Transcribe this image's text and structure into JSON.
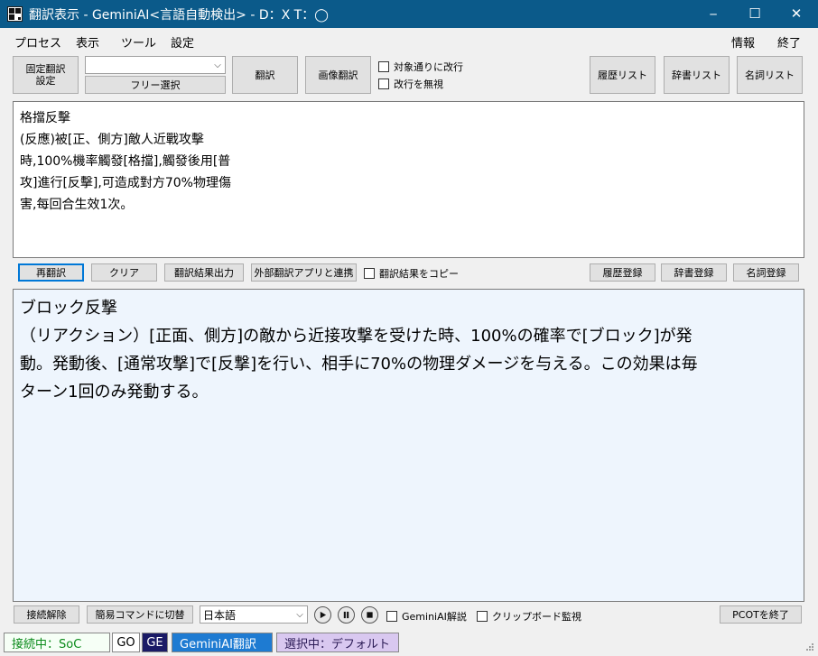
{
  "window": {
    "title": "翻訳表示 - GeminiAI<言語自動検出> - D：X T：◯",
    "minimize_glyph": "─",
    "maximize_glyph": "☐",
    "close_glyph": "✕"
  },
  "menu": {
    "items": [
      "プロセス",
      "表示",
      "ツール",
      "設定"
    ],
    "right_items": [
      "情報",
      "終了"
    ]
  },
  "toolbar": {
    "fixed_translation_settings": "固定翻訳\n設定",
    "combo_value": "",
    "free_select": "フリー選択",
    "translate": "翻訳",
    "image_translate": "画像翻訳",
    "check_newline_per_target": "対象通りに改行",
    "check_ignore_newline": "改行を無視",
    "history_list": "履歴リスト",
    "dictionary_list": "辞書リスト",
    "noun_list": "名詞リスト"
  },
  "source": {
    "text": "格擋反擊\n(反應)被[正、側方]敵人近戰攻擊\n時,100%機率觸發[格擋],觸發後用[普\n攻]進行[反擊],可造成對方70%物理傷\n害,每回合生效1次。"
  },
  "midbar": {
    "retranslate": "再翻訳",
    "clear": "クリア",
    "output_result": "翻訳結果出力",
    "external_link": "外部翻訳アプリと連携",
    "copy_result": "翻訳結果をコピー",
    "history_register": "履歴登録",
    "dictionary_register": "辞書登録",
    "noun_register": "名詞登録"
  },
  "result": {
    "text": "ブロック反撃\n（リアクション）[正面、側方]の敵から近接攻撃を受けた時、100%の確率で[ブロック]が発\n動。発動後、[通常攻撃]で[反撃]を行い、相手に70%の物理ダメージを与える。この効果は毎\nターン1回のみ発動する。"
  },
  "bottombar": {
    "disconnect": "接続解除",
    "simple_command": "簡易コマンドに切替",
    "language": "日本語",
    "gemini_explain": "GeminiAI解説",
    "clipboard_monitor": "クリップボード監視",
    "quit_pcot": "PCOTを終了"
  },
  "status": {
    "connected": "接続中：SoC",
    "go": "GO",
    "ge": "GE",
    "engine": "GeminiAI翻訳",
    "selected": "選択中：デフォルト"
  },
  "colors": {
    "titlebar": "#0b5a8a",
    "connected_text": "#0a8a1a",
    "engine_bg": "#1e7bd2",
    "ge_bg": "#1a1a66",
    "selected_bg": "#d9c8f0"
  }
}
